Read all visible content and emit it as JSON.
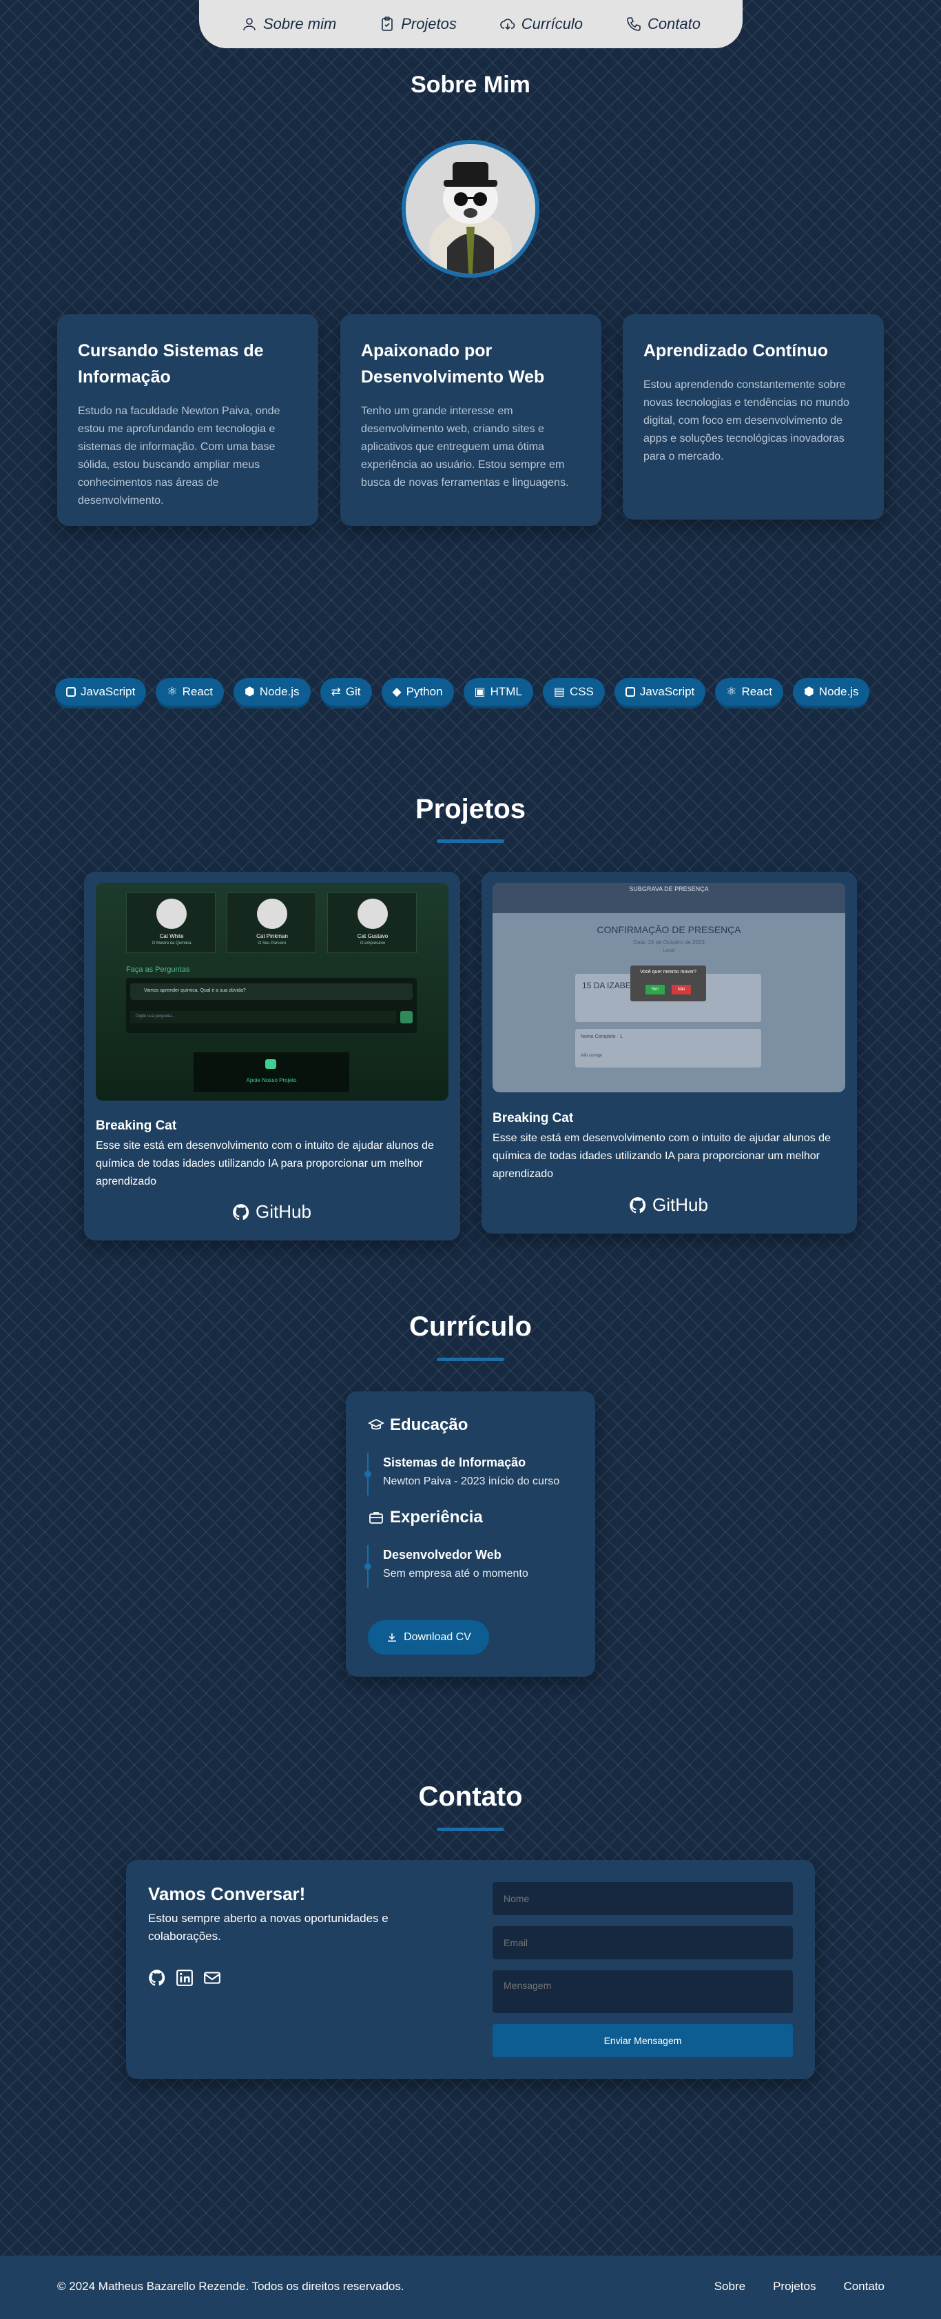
{
  "nav": [
    {
      "label": "Sobre mim",
      "icon": "user-icon"
    },
    {
      "label": "Projetos",
      "icon": "clipboard-icon"
    },
    {
      "label": "Currículo",
      "icon": "cloud-download-icon"
    },
    {
      "label": "Contato",
      "icon": "phone-icon"
    }
  ],
  "about": {
    "title": "Sobre Mim",
    "cards": [
      {
        "title": "Cursando Sistemas de Informação",
        "text": "Estudo na faculdade Newton Paiva, onde estou me aprofundando em tecnologia e sistemas de informação. Com uma base sólida, estou buscando ampliar meus conhecimentos nas áreas de desenvolvimento."
      },
      {
        "title": "Apaixonado por Desenvolvimento Web",
        "text": "Tenho um grande interesse em desenvolvimento web, criando sites e aplicativos que entreguem uma ótima experiência ao usuário. Estou sempre em busca de novas ferramentas e linguagens."
      },
      {
        "title": "Aprendizado Contínuo",
        "text": "Estou aprendendo constantemente sobre novas tecnologias e tendências no mundo digital, com foco em desenvolvimento de apps e soluções tecnológicas inovadoras para o mercado."
      }
    ]
  },
  "skills": [
    "JavaScript",
    "React",
    "Node.js",
    "Git",
    "Python",
    "HTML",
    "CSS",
    "JavaScript",
    "React",
    "Node.js"
  ],
  "projects": {
    "title": "Projetos",
    "items": [
      {
        "title": "Breaking Cat",
        "text": "Esse site está em desenvolvimento com o intuito de ajudar alunos de química de todas idades utilizando IA para proporcionar um melhor aprendizado",
        "link": "GitHub",
        "preview": {
          "cats": [
            "Cat White",
            "Cat Pinkman",
            "Cat Gustavo"
          ],
          "subs": [
            "O Mestre da Química",
            "O Seu Parceiro",
            "O empresário"
          ],
          "ask": "Faça as Perguntas",
          "q": "Vamos aprender química. Qual é a sua dúvida?",
          "placeholder": "Digite sua pergunta...",
          "footer": "Apoie Nosso Projeto"
        }
      },
      {
        "title": "Breaking Cat",
        "text": "Esse site está em desenvolvimento com o intuito de ajudar alunos de química de todas idades utilizando IA para proporcionar um melhor aprendizado",
        "link": "GitHub",
        "preview": {
          "header": "SUBGRAVA DE PRESENÇA",
          "heading": "CONFIRMAÇÃO DE PRESENÇA",
          "date": "Data: 15 de Outubro de 2023",
          "local": "Local",
          "name": "15 DA IZABELA",
          "dialog": "Você quer mesmo mover?",
          "yes": "Sim",
          "no": "Não",
          "companions": "Nome Completo · 1",
          "add": "Irão comigo"
        }
      }
    ]
  },
  "cv": {
    "title": "Currículo",
    "edu_title": "Educação",
    "edu": {
      "title": "Sistemas de Informação",
      "sub": "Newton Paiva - 2023 início do curso"
    },
    "exp_title": "Experiência",
    "exp": {
      "title": "Desenvolvedor Web",
      "sub": "Sem empresa até o momento"
    },
    "download": "Download CV"
  },
  "contact": {
    "title": "Contato",
    "heading": "Vamos Conversar!",
    "text": "Estou sempre aberto a novas oportunidades e colaborações.",
    "name_ph": "Nome",
    "email_ph": "Email",
    "msg_ph": "Mensagem",
    "send": "Enviar Mensagem"
  },
  "footer": {
    "copy": "© 2024 Matheus Bazarello Rezende. Todos os direitos reservados.",
    "links": [
      "Sobre",
      "Projetos",
      "Contato"
    ]
  },
  "colors": {
    "accent": "#0d5d92",
    "card": "#1f4060",
    "background": "#172a42",
    "nav": "#e3e3e3"
  }
}
